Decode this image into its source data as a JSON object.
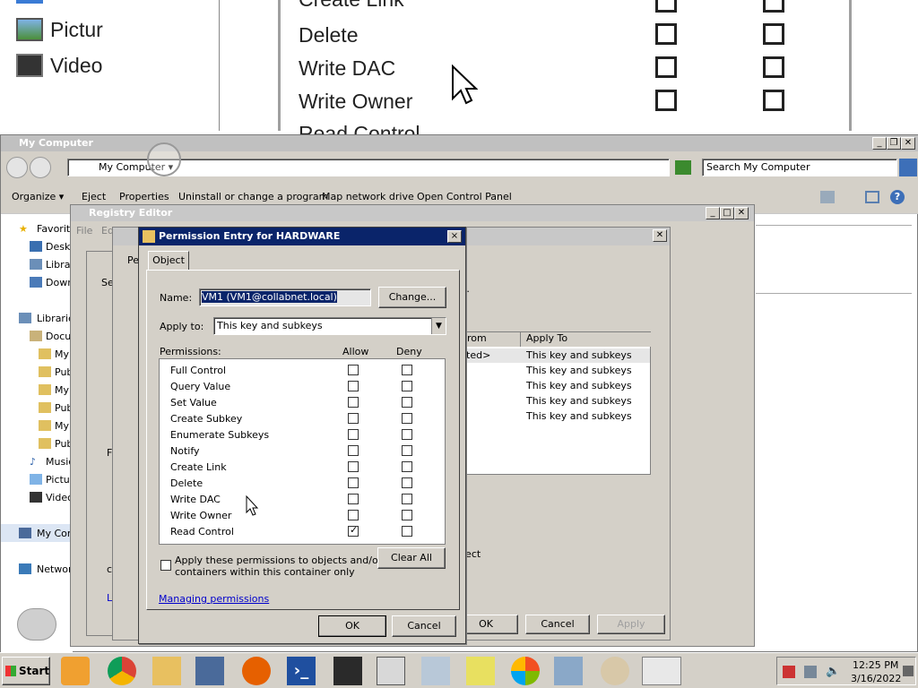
{
  "zoom": {
    "left_items": [
      "Pictur",
      "Video"
    ],
    "right_items": [
      "Create Link",
      "Delete",
      "Write DAC",
      "Write Owner",
      "Read Control"
    ]
  },
  "explorer": {
    "title": "My Computer",
    "address": "My Computer",
    "search_placeholder": "Search My Computer",
    "commands": [
      "Organize",
      "Eject",
      "Properties",
      "Uninstall or change a program",
      "Map network drive",
      "Open Control Panel"
    ],
    "nav": [
      "Favorit",
      "Deskt",
      "Librar",
      "Down",
      "Librarie",
      "Docu",
      "My",
      "Pub",
      "My",
      "Pub",
      "My",
      "Pub",
      "Music",
      "Pictur",
      "Video",
      "My Com",
      "Networ"
    ]
  },
  "registry": {
    "title": "Registry Editor",
    "menu": [
      "File",
      "Ed"
    ],
    "bg_table_headers": [
      "rom",
      "Apply To"
    ],
    "bg_rows": [
      {
        "from": "ited>",
        "apply": "This key and subkeys"
      },
      {
        "from": "",
        "apply": "This key and subkeys"
      },
      {
        "from": "",
        "apply": "This key and subkeys"
      },
      {
        "from": "",
        "apply": "This key and subkeys"
      },
      {
        "from": "",
        "apply": "This key and subkeys"
      }
    ],
    "bg_buttons": [
      "OK",
      "Cancel",
      "Apply"
    ],
    "bg_fragments": [
      "Se",
      "Pe",
      "t.",
      "ject",
      "F",
      "c",
      "L",
      "M"
    ]
  },
  "dialog": {
    "title": "Permission Entry for HARDWARE",
    "close": "×",
    "tab": "Object",
    "name_label": "Name:",
    "name_value": "VM1 (VM1@collabnet.local)",
    "change_button": "Change...",
    "apply_to_label": "Apply to:",
    "apply_to_value": "This key and subkeys",
    "permissions_label": "Permissions:",
    "allow_header": "Allow",
    "deny_header": "Deny",
    "permissions": [
      {
        "name": "Full Control",
        "allow": false,
        "deny": false
      },
      {
        "name": "Query Value",
        "allow": false,
        "deny": false
      },
      {
        "name": "Set Value",
        "allow": false,
        "deny": false
      },
      {
        "name": "Create Subkey",
        "allow": false,
        "deny": false
      },
      {
        "name": "Enumerate Subkeys",
        "allow": false,
        "deny": false
      },
      {
        "name": "Notify",
        "allow": false,
        "deny": false
      },
      {
        "name": "Create Link",
        "allow": false,
        "deny": false
      },
      {
        "name": "Delete",
        "allow": false,
        "deny": false
      },
      {
        "name": "Write DAC",
        "allow": false,
        "deny": false
      },
      {
        "name": "Write Owner",
        "allow": false,
        "deny": false
      },
      {
        "name": "Read Control",
        "allow": true,
        "deny": false
      }
    ],
    "apply_inherit_label_1": "Apply these permissions to objects and/or",
    "apply_inherit_label_2": "containers within this container only",
    "clear_all": "Clear All",
    "managing_link": "Managing permissions",
    "ok": "OK",
    "cancel": "Cancel"
  },
  "taskbar": {
    "start": "Start",
    "time": "12:25 PM",
    "date": "3/16/2022"
  },
  "colors": {
    "title_active": "#0a246a",
    "link": "#0000cc"
  }
}
